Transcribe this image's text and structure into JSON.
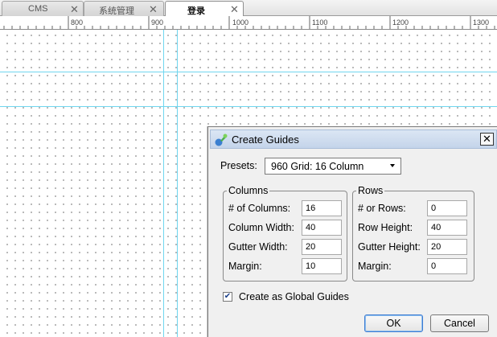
{
  "tabs": [
    {
      "label": "CMS",
      "active": false
    },
    {
      "label": "系统管理",
      "active": false
    },
    {
      "label": "登录",
      "active": true
    }
  ],
  "tab_close_glyph": "✕",
  "ruler": {
    "labels": [
      "800",
      "900",
      "1000",
      "1100",
      "1200",
      "1300"
    ]
  },
  "dialog": {
    "title": "Create Guides",
    "close_glyph": "✕",
    "presets_label": "Presets:",
    "presets_value": "960 Grid: 16 Column",
    "columns": {
      "legend": "Columns",
      "rows": [
        {
          "label": "# of Columns:",
          "value": "16"
        },
        {
          "label": "Column Width:",
          "value": "40"
        },
        {
          "label": "Gutter Width:",
          "value": "20"
        },
        {
          "label": "Margin:",
          "value": "10"
        }
      ]
    },
    "rows": {
      "legend": "Rows",
      "rows": [
        {
          "label": "# or Rows:",
          "value": "0"
        },
        {
          "label": "Row Height:",
          "value": "40"
        },
        {
          "label": "Gutter Height:",
          "value": "20"
        },
        {
          "label": "Margin:",
          "value": "0"
        }
      ]
    },
    "global_guides_label": "Create as Global Guides",
    "global_guides_checked": true,
    "check_glyph": "✔",
    "ok_label": "OK",
    "cancel_label": "Cancel"
  },
  "colors": {
    "guide": "#6fd6ef",
    "titlebar": "#c4d4ea",
    "dialog_bg": "#f0f0f0"
  }
}
